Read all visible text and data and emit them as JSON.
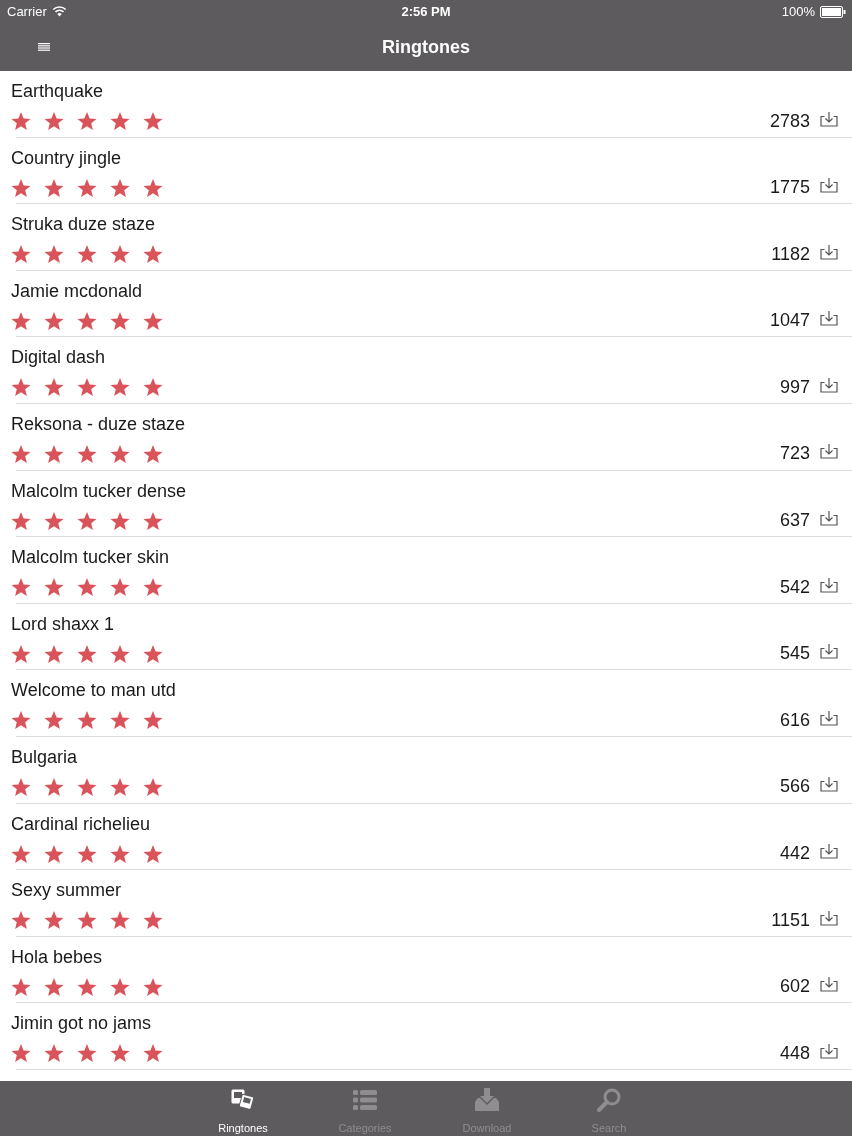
{
  "status_bar": {
    "carrier": "Carrier",
    "time": "2:56 PM",
    "battery": "100%"
  },
  "nav_bar": {
    "title": "Ringtones"
  },
  "ringtones": [
    {
      "title": "Earthquake",
      "stars": 5,
      "downloads": "2783"
    },
    {
      "title": "Country jingle",
      "stars": 5,
      "downloads": "1775"
    },
    {
      "title": "Struka duze staze",
      "stars": 5,
      "downloads": "1182"
    },
    {
      "title": "Jamie mcdonald",
      "stars": 5,
      "downloads": "1047"
    },
    {
      "title": "Digital dash",
      "stars": 5,
      "downloads": "997"
    },
    {
      "title": "Reksona - duze staze",
      "stars": 5,
      "downloads": "723"
    },
    {
      "title": "Malcolm tucker dense",
      "stars": 5,
      "downloads": "637"
    },
    {
      "title": "Malcolm tucker skin",
      "stars": 5,
      "downloads": "542"
    },
    {
      "title": "Lord shaxx 1",
      "stars": 5,
      "downloads": "545"
    },
    {
      "title": "Welcome to man utd",
      "stars": 5,
      "downloads": "616"
    },
    {
      "title": "Bulgaria",
      "stars": 5,
      "downloads": "566"
    },
    {
      "title": "Cardinal richelieu",
      "stars": 5,
      "downloads": "442"
    },
    {
      "title": "Sexy summer",
      "stars": 5,
      "downloads": "1151"
    },
    {
      "title": "Hola bebes",
      "stars": 5,
      "downloads": "602"
    },
    {
      "title": "Jimin got no jams",
      "stars": 5,
      "downloads": "448"
    }
  ],
  "tab_bar": [
    {
      "label": "Ringtones",
      "selected": true
    },
    {
      "label": "Categories",
      "selected": false
    },
    {
      "label": "Download",
      "selected": false
    },
    {
      "label": "Search",
      "selected": false
    }
  ]
}
